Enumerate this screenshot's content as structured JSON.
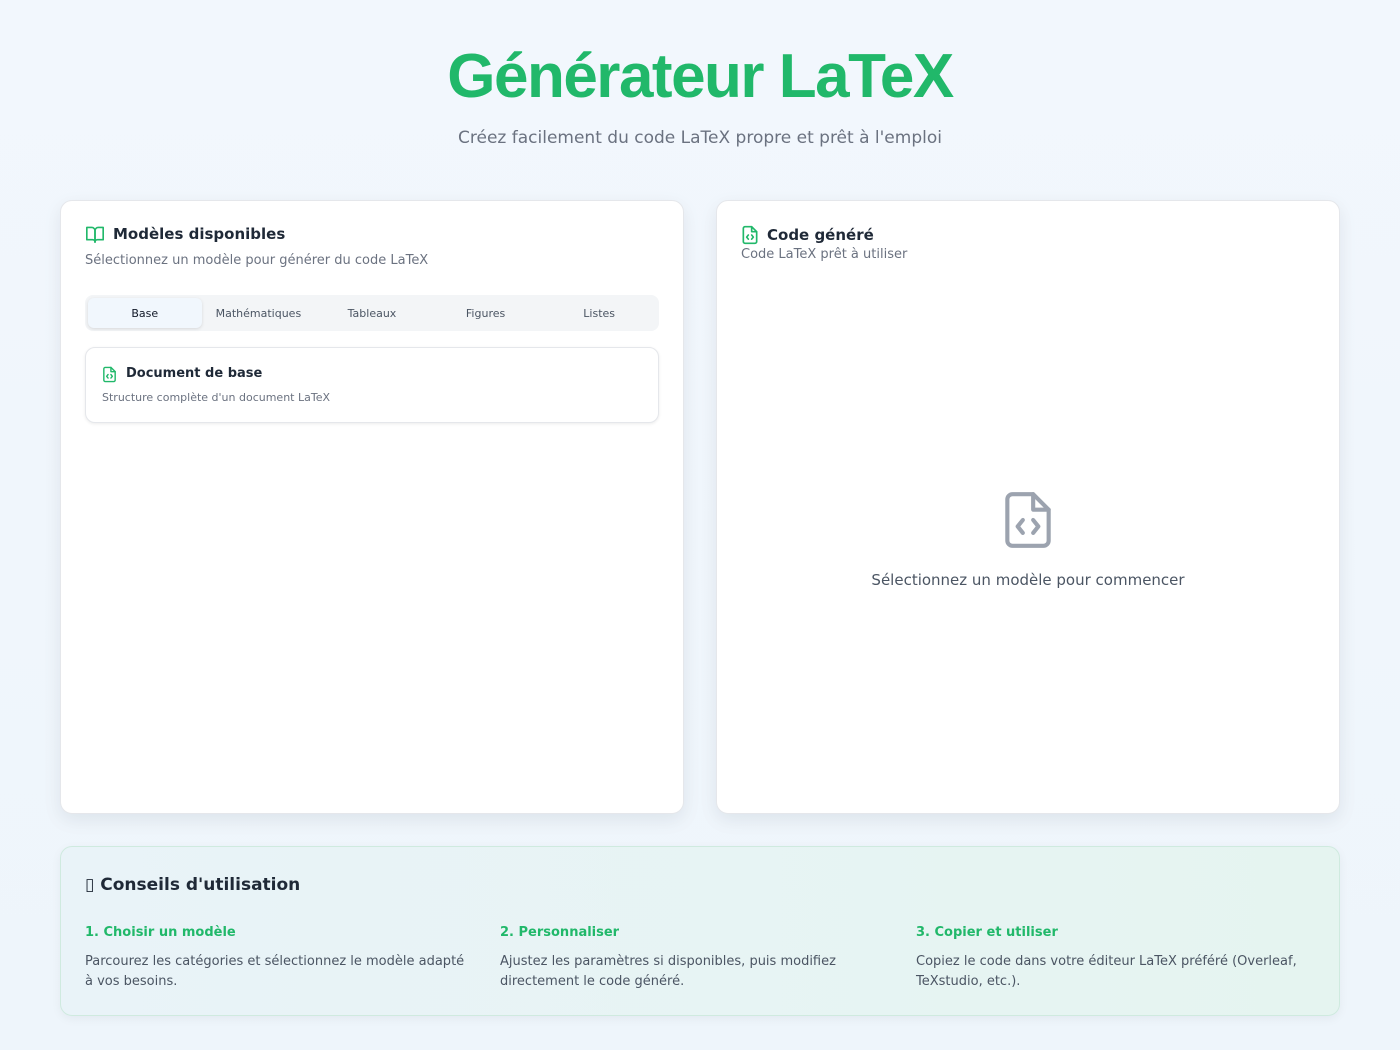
{
  "header": {
    "title": "Générateur LaTeX",
    "subtitle": "Créez facilement du code LaTeX propre et prêt à l'emploi"
  },
  "colors": {
    "accent": "#21b86a",
    "text": "#1f2937",
    "muted": "#6b7280"
  },
  "models_panel": {
    "icon": "book-open-icon",
    "title": "Modèles disponibles",
    "description": "Sélectionnez un modèle pour générer du code LaTeX",
    "tabs": [
      {
        "label": "Base",
        "active": true
      },
      {
        "label": "Mathématiques",
        "active": false
      },
      {
        "label": "Tableaux",
        "active": false
      },
      {
        "label": "Figures",
        "active": false
      },
      {
        "label": "Listes",
        "active": false
      }
    ],
    "templates": [
      {
        "icon": "file-code-icon",
        "title": "Document de base",
        "description": "Structure complète d'un document LaTeX"
      }
    ]
  },
  "code_panel": {
    "icon": "file-code-icon",
    "title": "Code généré",
    "description": "Code LaTeX prêt à utiliser",
    "empty_icon": "file-code-icon",
    "empty_text": "Sélectionnez un modèle pour commencer"
  },
  "tips": {
    "title": "▯ Conseils d'utilisation",
    "items": [
      {
        "title": "1. Choisir un modèle",
        "text": "Parcourez les catégories et sélectionnez le modèle adapté à vos besoins."
      },
      {
        "title": "2. Personnaliser",
        "text": "Ajustez les paramètres si disponibles, puis modifiez directement le code généré."
      },
      {
        "title": "3. Copier et utiliser",
        "text": "Copiez le code dans votre éditeur LaTeX préféré (Overleaf, TeXstudio, etc.)."
      }
    ]
  }
}
